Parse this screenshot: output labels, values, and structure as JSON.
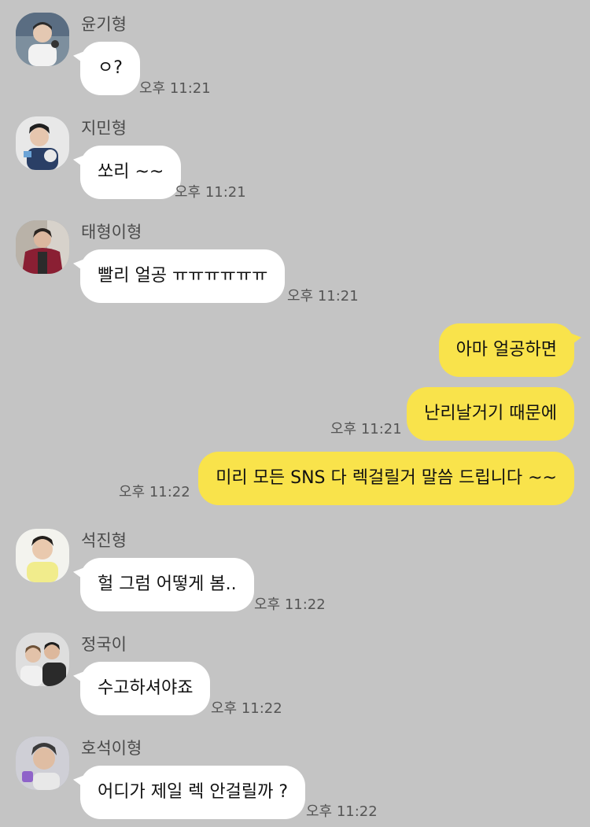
{
  "colors": {
    "background": "#c4c4c4",
    "incoming_bubble": "#ffffff",
    "outgoing_bubble": "#f9e34b"
  },
  "messages": [
    {
      "sender": "윤기형",
      "avatar_icon": "profile-photo-icon",
      "text": "ㅇ?",
      "time": "오후 11:21"
    },
    {
      "sender": "지민형",
      "avatar_icon": "profile-photo-icon",
      "text": "쏘리 ~~",
      "time": "오후 11:21"
    },
    {
      "sender": "태형이형",
      "avatar_icon": "profile-photo-icon",
      "text": "빨리 얼공 ㅠㅠㅠㅠㅠㅠ",
      "time": "오후 11:21"
    },
    {
      "sender": "",
      "text": "아마 얼공하면",
      "time": ""
    },
    {
      "sender": "",
      "text": "난리날거기 때문에",
      "time": "오후 11:21"
    },
    {
      "sender": "",
      "text": "미리 모든 SNS 다 렉걸릴거 말씀 드립니다 ~~",
      "time": "오후 11:22"
    },
    {
      "sender": "석진형",
      "avatar_icon": "profile-photo-icon",
      "text": "헐 그럼 어떻게 봄..",
      "time": "오후 11:22"
    },
    {
      "sender": "정국이",
      "avatar_icon": "profile-photo-icon",
      "text": "수고하셔야죠",
      "time": "오후 11:22"
    },
    {
      "sender": "호석이형",
      "avatar_icon": "profile-photo-icon",
      "text": "어디가 제일 렉 안걸릴까 ?",
      "time": "오후 11:22"
    }
  ]
}
